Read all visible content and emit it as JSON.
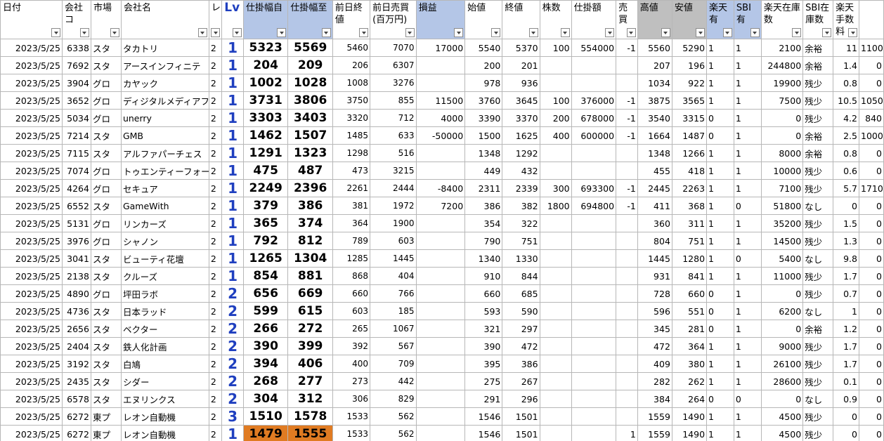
{
  "headers": [
    "日付",
    "会社コ",
    "市場",
    "会社名",
    "レ",
    "Lv",
    "仕掛幅自",
    "仕掛幅至",
    "前日終値",
    "前日売買(百万円)",
    "損益",
    "始値",
    "終値",
    "株数",
    "仕掛額",
    "売買",
    "高値",
    "安値",
    "楽天有",
    "SBI有",
    "楽天在庫数",
    "SBI在庫数",
    "楽天手数料",
    ""
  ],
  "rows": [
    [
      "2023/5/25",
      "6338",
      "スタ",
      "タカトリ",
      "2",
      "1",
      "5323",
      "5569",
      "5460",
      "7070",
      "17000",
      "5540",
      "5370",
      "100",
      "554000",
      "-1",
      "5560",
      "5290",
      "1",
      "1",
      "2100",
      "余裕",
      "11",
      "1100"
    ],
    [
      "2023/5/25",
      "7692",
      "スタ",
      "アースインフィニテ",
      "2",
      "1",
      "204",
      "209",
      "206",
      "6307",
      "",
      "200",
      "201",
      "",
      "",
      "",
      "207",
      "196",
      "1",
      "1",
      "244800",
      "余裕",
      "1.4",
      "0"
    ],
    [
      "2023/5/25",
      "3904",
      "グロ",
      "カヤック",
      "2",
      "1",
      "1002",
      "1028",
      "1008",
      "3276",
      "",
      "978",
      "936",
      "",
      "",
      "",
      "1034",
      "922",
      "1",
      "1",
      "19900",
      "残少",
      "0.8",
      "0"
    ],
    [
      "2023/5/25",
      "3652",
      "グロ",
      "ディジタルメディアフ",
      "2",
      "1",
      "3731",
      "3806",
      "3750",
      "855",
      "11500",
      "3760",
      "3645",
      "100",
      "376000",
      "-1",
      "3875",
      "3565",
      "1",
      "1",
      "7500",
      "残少",
      "10.5",
      "1050"
    ],
    [
      "2023/5/25",
      "5034",
      "グロ",
      "unerry",
      "2",
      "1",
      "3303",
      "3403",
      "3320",
      "712",
      "4000",
      "3390",
      "3370",
      "200",
      "678000",
      "-1",
      "3540",
      "3315",
      "0",
      "1",
      "0",
      "残少",
      "4.2",
      "840"
    ],
    [
      "2023/5/25",
      "7214",
      "スタ",
      "GMB",
      "2",
      "1",
      "1462",
      "1507",
      "1485",
      "633",
      "-50000",
      "1500",
      "1625",
      "400",
      "600000",
      "-1",
      "1664",
      "1487",
      "0",
      "1",
      "0",
      "余裕",
      "2.5",
      "1000"
    ],
    [
      "2023/5/25",
      "7115",
      "スタ",
      "アルファパーチェス",
      "2",
      "1",
      "1291",
      "1323",
      "1298",
      "516",
      "",
      "1348",
      "1292",
      "",
      "",
      "",
      "1348",
      "1266",
      "1",
      "1",
      "8000",
      "余裕",
      "0.8",
      "0"
    ],
    [
      "2023/5/25",
      "7074",
      "グロ",
      "トゥエンティーフォー",
      "2",
      "1",
      "475",
      "487",
      "473",
      "3215",
      "",
      "449",
      "432",
      "",
      "",
      "",
      "455",
      "418",
      "1",
      "1",
      "10000",
      "残少",
      "0.6",
      "0"
    ],
    [
      "2023/5/25",
      "4264",
      "グロ",
      "セキュア",
      "2",
      "1",
      "2249",
      "2396",
      "2261",
      "2444",
      "-8400",
      "2311",
      "2339",
      "300",
      "693300",
      "-1",
      "2445",
      "2263",
      "1",
      "1",
      "7100",
      "残少",
      "5.7",
      "1710"
    ],
    [
      "2023/5/25",
      "6552",
      "スタ",
      "GameWith",
      "2",
      "1",
      "379",
      "386",
      "381",
      "1972",
      "7200",
      "386",
      "382",
      "1800",
      "694800",
      "-1",
      "411",
      "368",
      "1",
      "0",
      "51800",
      "なし",
      "0",
      "0"
    ],
    [
      "2023/5/25",
      "5131",
      "グロ",
      "リンカーズ",
      "2",
      "1",
      "365",
      "374",
      "364",
      "1900",
      "",
      "354",
      "322",
      "",
      "",
      "",
      "360",
      "311",
      "1",
      "1",
      "35200",
      "残少",
      "1.5",
      "0"
    ],
    [
      "2023/5/25",
      "3976",
      "グロ",
      "シャノン",
      "2",
      "1",
      "792",
      "812",
      "789",
      "603",
      "",
      "790",
      "751",
      "",
      "",
      "",
      "804",
      "751",
      "1",
      "1",
      "14500",
      "残少",
      "1.3",
      "0"
    ],
    [
      "2023/5/25",
      "3041",
      "スタ",
      "ビューティ花壇",
      "2",
      "1",
      "1265",
      "1304",
      "1285",
      "1445",
      "",
      "1340",
      "1330",
      "",
      "",
      "",
      "1445",
      "1280",
      "1",
      "0",
      "5400",
      "なし",
      "9.8",
      "0"
    ],
    [
      "2023/5/25",
      "2138",
      "スタ",
      "クルーズ",
      "2",
      "1",
      "854",
      "881",
      "868",
      "404",
      "",
      "910",
      "844",
      "",
      "",
      "",
      "931",
      "841",
      "1",
      "1",
      "11000",
      "残少",
      "1.7",
      "0"
    ],
    [
      "2023/5/25",
      "4890",
      "グロ",
      "坪田ラボ",
      "2",
      "2",
      "656",
      "669",
      "660",
      "766",
      "",
      "660",
      "685",
      "",
      "",
      "",
      "728",
      "660",
      "0",
      "1",
      "0",
      "残少",
      "0.7",
      "0"
    ],
    [
      "2023/5/25",
      "4736",
      "スタ",
      "日本ラッド",
      "2",
      "2",
      "599",
      "615",
      "603",
      "185",
      "",
      "593",
      "590",
      "",
      "",
      "",
      "596",
      "551",
      "0",
      "1",
      "6200",
      "なし",
      "1",
      "0"
    ],
    [
      "2023/5/25",
      "2656",
      "スタ",
      "ベクター",
      "2",
      "2",
      "266",
      "272",
      "265",
      "1067",
      "",
      "321",
      "297",
      "",
      "",
      "",
      "345",
      "281",
      "0",
      "1",
      "0",
      "余裕",
      "1.2",
      "0"
    ],
    [
      "2023/5/25",
      "2404",
      "スタ",
      "鉄人化計画",
      "2",
      "2",
      "390",
      "399",
      "392",
      "567",
      "",
      "390",
      "472",
      "",
      "",
      "",
      "472",
      "364",
      "1",
      "1",
      "9000",
      "残少",
      "1.7",
      "0"
    ],
    [
      "2023/5/25",
      "3192",
      "スタ",
      "白鳩",
      "2",
      "2",
      "394",
      "406",
      "400",
      "709",
      "",
      "395",
      "386",
      "",
      "",
      "",
      "409",
      "380",
      "1",
      "1",
      "26100",
      "残少",
      "1.7",
      "0"
    ],
    [
      "2023/5/25",
      "2435",
      "スタ",
      "シダー",
      "2",
      "2",
      "268",
      "277",
      "273",
      "442",
      "",
      "275",
      "267",
      "",
      "",
      "",
      "282",
      "262",
      "1",
      "1",
      "28600",
      "残少",
      "0.1",
      "0"
    ],
    [
      "2023/5/25",
      "6578",
      "スタ",
      "エヌリンクス",
      "2",
      "2",
      "304",
      "312",
      "306",
      "829",
      "",
      "291",
      "296",
      "",
      "",
      "",
      "384",
      "264",
      "0",
      "0",
      "0",
      "なし",
      "0.9",
      "0"
    ],
    [
      "2023/5/25",
      "6272",
      "東プ",
      "レオン自動機",
      "2",
      "3",
      "1510",
      "1578",
      "1533",
      "562",
      "",
      "1546",
      "1501",
      "",
      "",
      "",
      "1559",
      "1490",
      "1",
      "1",
      "4500",
      "残少",
      "0",
      "0"
    ],
    [
      "2023/5/25",
      "6272",
      "東プ",
      "レオン自動機",
      "2",
      "1",
      "1479",
      "1555",
      "1533",
      "562",
      "",
      "1546",
      "1501",
      "",
      "",
      "1",
      "1559",
      "1490",
      "1",
      "1",
      "4500",
      "残少",
      "0",
      "0"
    ]
  ],
  "highlight_row": 22,
  "colors": {
    "header_blue": "#b4c6e7",
    "header_gray": "#bfbfbf",
    "lv_blue": "#1f3fbf",
    "highlight_orange": "#e07b22"
  }
}
